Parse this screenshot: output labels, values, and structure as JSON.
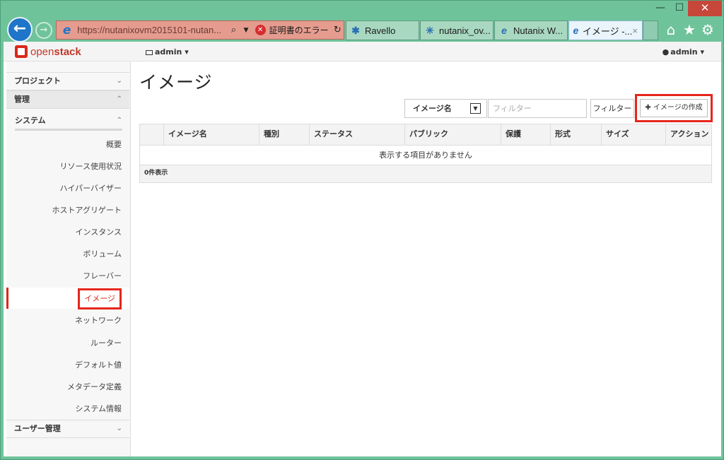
{
  "browser": {
    "address_url": "https://nutanixovm2015101-nutan...",
    "cert_error": "証明書のエラー",
    "tabs": [
      {
        "label": "Ravello",
        "icon": "ravello-icon",
        "active": false
      },
      {
        "label": "nutanix_ov...",
        "icon": "pinwheel-icon",
        "active": false
      },
      {
        "label": "Nutanix W...",
        "icon": "ie-icon",
        "active": false
      },
      {
        "label": "イメージ -...",
        "icon": "ie-icon",
        "active": true
      }
    ],
    "close_tab": "×"
  },
  "topbar": {
    "brand_prefix": "open",
    "brand_suffix": "stack",
    "project_menu": "admin ▾",
    "user_menu": "admin ▾"
  },
  "sidebar": {
    "project": "プロジェクト",
    "admin": "管理",
    "system": "システム",
    "items": [
      {
        "label": "概要"
      },
      {
        "label": "リソース使用状況"
      },
      {
        "label": "ハイパーバイザー"
      },
      {
        "label": "ホストアグリゲート"
      },
      {
        "label": "インスタンス"
      },
      {
        "label": "ボリューム"
      },
      {
        "label": "フレーバー"
      },
      {
        "label": "イメージ",
        "active": true
      },
      {
        "label": "ネットワーク"
      },
      {
        "label": "ルーター"
      },
      {
        "label": "デフォルト値"
      },
      {
        "label": "メタデータ定義"
      },
      {
        "label": "システム情報"
      }
    ],
    "identity": "ユーザー管理"
  },
  "main": {
    "title": "イメージ",
    "filter_select": "イメージ名",
    "filter_placeholder": "フィルター",
    "filter_button": "フィルター",
    "create_button": "✚ イメージの作成",
    "columns": [
      "イメージ名",
      "種別",
      "ステータス",
      "パブリック",
      "保護",
      "形式",
      "サイズ",
      "アクション"
    ],
    "empty_message": "表示する項目がありません",
    "footer": "0件表示"
  },
  "colors": {
    "accent": "#d9291b",
    "chrome": "#6fc39b",
    "highlight": "#e5261c"
  }
}
